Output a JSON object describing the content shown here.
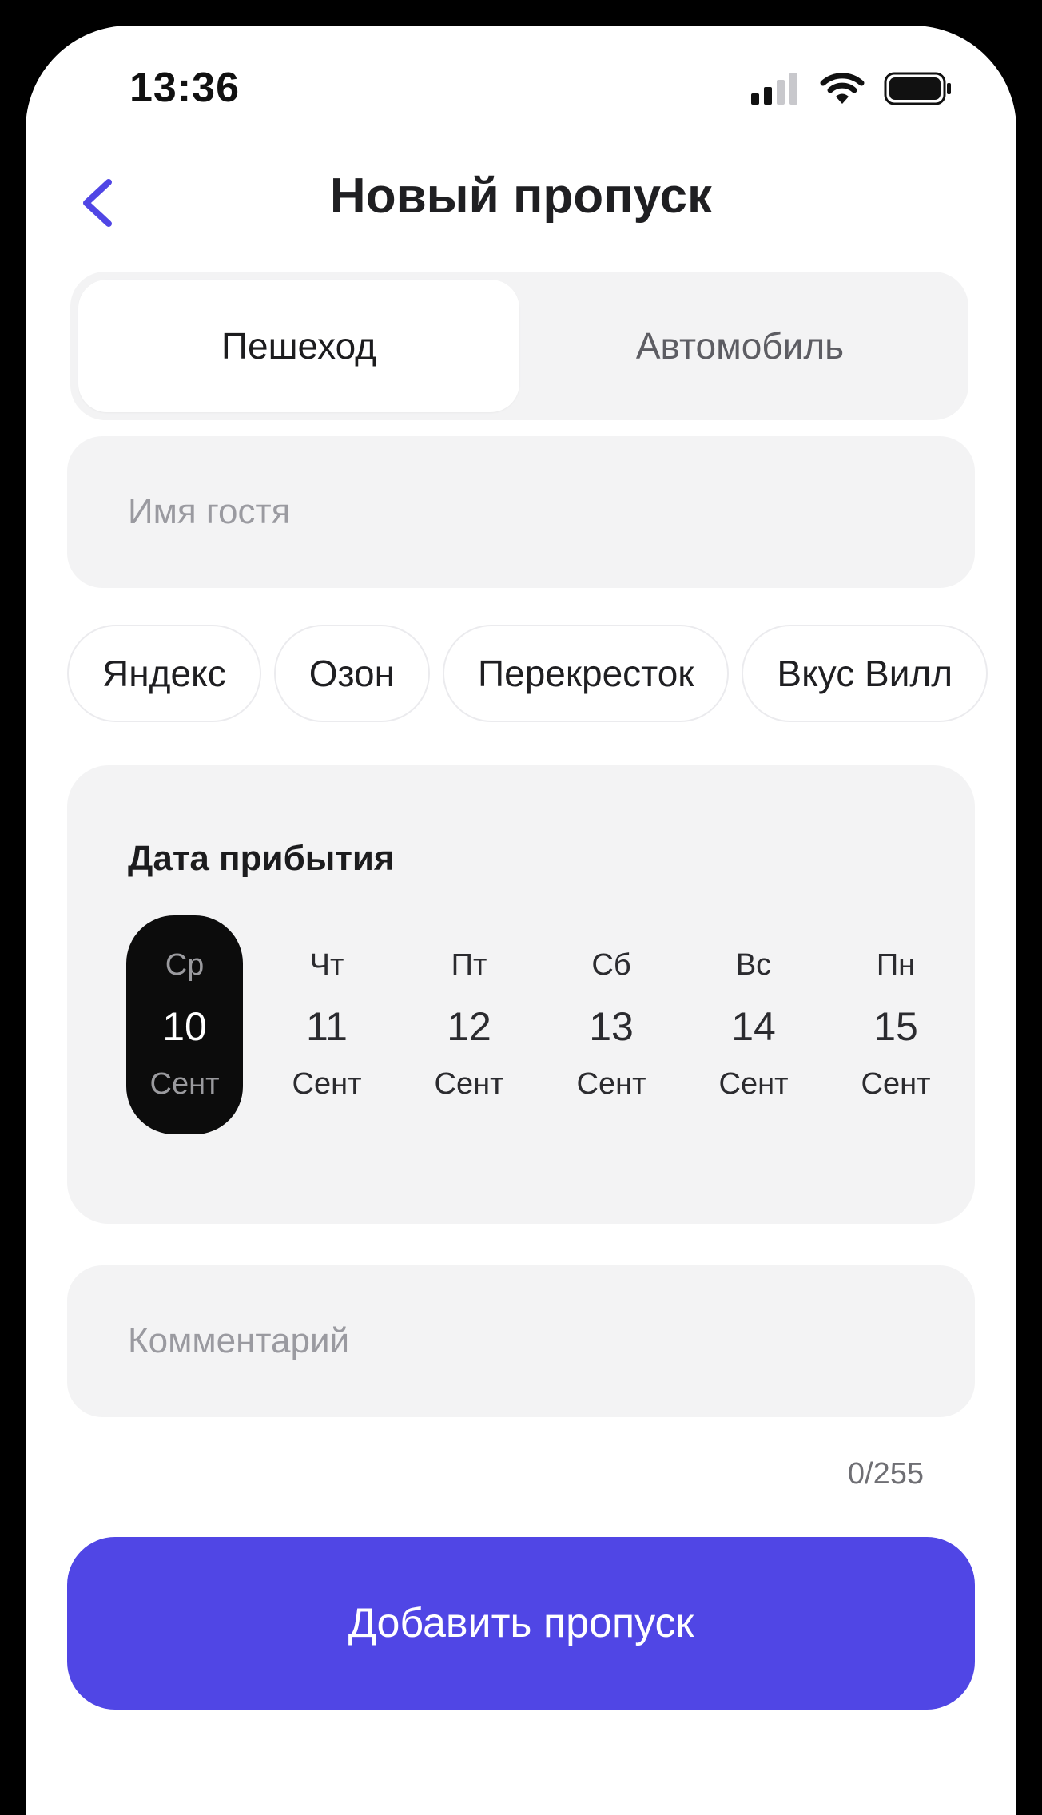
{
  "status_bar": {
    "time": "13:36"
  },
  "header": {
    "title": "Новый пропуск",
    "back_icon": "chevron-left-icon",
    "accent_color": "#5046e5"
  },
  "tabs": [
    {
      "label": "Пешеход",
      "active": true
    },
    {
      "label": "Автомобиль",
      "active": false
    }
  ],
  "guest_name": {
    "placeholder": "Имя гостя",
    "value": ""
  },
  "quick_chips": [
    "Яндекс",
    "Озон",
    "Перекресток",
    "Вкус Вилл"
  ],
  "arrival": {
    "label": "Дата прибытия",
    "days": [
      {
        "weekday": "Ср",
        "day": "10",
        "month": "Сент",
        "selected": true
      },
      {
        "weekday": "Чт",
        "day": "11",
        "month": "Сент",
        "selected": false
      },
      {
        "weekday": "Пт",
        "day": "12",
        "month": "Сент",
        "selected": false
      },
      {
        "weekday": "Сб",
        "day": "13",
        "month": "Сент",
        "selected": false
      },
      {
        "weekday": "Вс",
        "day": "14",
        "month": "Сент",
        "selected": false
      },
      {
        "weekday": "Пн",
        "day": "15",
        "month": "Сент",
        "selected": false
      }
    ]
  },
  "comment": {
    "placeholder": "Комментарий",
    "value": "",
    "counter": "0/255"
  },
  "submit": {
    "label": "Добавить пропуск",
    "color": "#5046e5"
  }
}
